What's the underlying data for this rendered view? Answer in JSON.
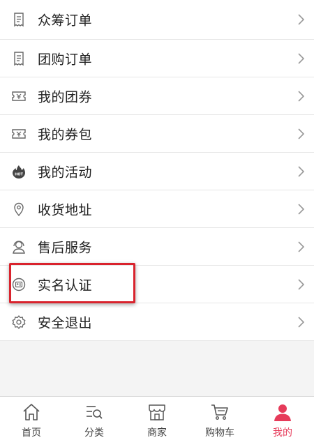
{
  "menu": {
    "items": [
      {
        "label": "众筹订单",
        "icon": "receipt-icon"
      },
      {
        "label": "团购订单",
        "icon": "receipt-icon"
      },
      {
        "label": "我的团券",
        "icon": "ticket-icon"
      },
      {
        "label": "我的券包",
        "icon": "ticket-icon"
      },
      {
        "label": "我的活动",
        "icon": "hot-activity-icon"
      },
      {
        "label": "收货地址",
        "icon": "location-pin-icon"
      },
      {
        "label": "售后服务",
        "icon": "customer-service-icon"
      },
      {
        "label": "实名认证",
        "icon": "id-verify-icon"
      },
      {
        "label": "安全退出",
        "icon": "gear-icon"
      }
    ]
  },
  "highlight": {
    "target": "实名认证",
    "color": "#d9232d"
  },
  "tabbar": {
    "tabs": [
      {
        "label": "首页",
        "icon": "home-icon"
      },
      {
        "label": "分类",
        "icon": "category-icon"
      },
      {
        "label": "商家",
        "icon": "store-icon"
      },
      {
        "label": "购物车",
        "icon": "cart-icon"
      },
      {
        "label": "我的",
        "icon": "user-icon"
      }
    ],
    "active": "我的",
    "active_color": "#e63b5a"
  }
}
